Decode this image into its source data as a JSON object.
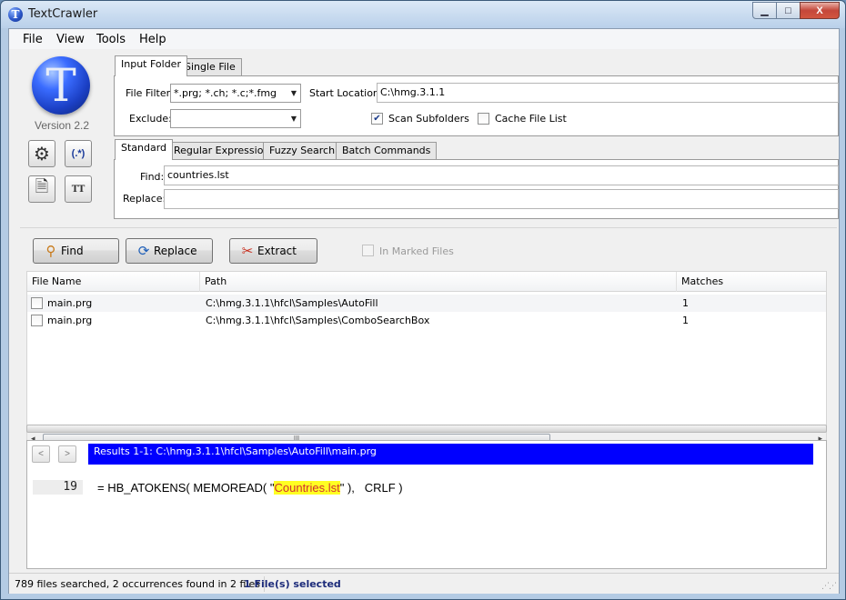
{
  "window": {
    "title": "TextCrawler",
    "app_icon_letter": "T",
    "minimize_glyph": "▁",
    "maximize_glyph": "□",
    "close_glyph": "X"
  },
  "menu": {
    "items": [
      "File",
      "View",
      "Tools",
      "Help"
    ]
  },
  "sidebar": {
    "logo_letter": "T",
    "version": "Version 2.2",
    "buttons": [
      {
        "icon": "gear-icon",
        "glyph": "⚙"
      },
      {
        "icon": "regex-icon",
        "glyph": "(.*)"
      },
      {
        "icon": "document-icon",
        "glyph": "🗎"
      },
      {
        "icon": "text-case-icon",
        "glyph": "TT"
      }
    ]
  },
  "source_tabs": {
    "tabs": [
      "Input Folder",
      "Single File"
    ],
    "active": "Input Folder"
  },
  "source": {
    "file_filter_label": "File Filter:",
    "file_filter_value": "*.prg; *.ch; *.c;*.fmg",
    "start_location_label": "Start Location:",
    "start_location_value": "C:\\hmg.3.1.1",
    "exclude_label": "Exclude:",
    "exclude_value": "",
    "scan_subfolders_label": "Scan Subfolders",
    "scan_subfolders_checked": true,
    "cache_file_list_label": "Cache File List",
    "cache_file_list_checked": false
  },
  "search_tabs": {
    "tabs": [
      "Standard",
      "Regular Expression",
      "Fuzzy Search",
      "Batch Commands"
    ],
    "active": "Standard"
  },
  "search": {
    "find_label": "Find:",
    "find_value": "countries.lst",
    "replace_label": "Replace:",
    "replace_value": ""
  },
  "toolbar": {
    "find_label": "Find",
    "replace_label": "Replace",
    "extract_label": "Extract",
    "in_marked_files_label": "In Marked Files",
    "in_marked_files_checked": false
  },
  "file_list": {
    "columns": [
      "File Name",
      "Path",
      "Matches"
    ],
    "rows": [
      {
        "name": "main.prg",
        "path": "C:\\hmg.3.1.1\\hfcl\\Samples\\AutoFill",
        "matches": "1",
        "checked": false
      },
      {
        "name": "main.prg",
        "path": "C:\\hmg.3.1.1\\hfcl\\Samples\\ComboSearchBox",
        "matches": "1",
        "checked": false
      }
    ],
    "scroll_left_glyph": "◂",
    "scroll_right_glyph": "▸",
    "scroll_thumb_grip": "|||"
  },
  "results": {
    "prev_glyph": "<",
    "next_glyph": ">",
    "header": "Results 1-1: C:\\hmg.3.1.1\\hfcl\\Samples\\AutoFill\\main.prg",
    "line_number": "19",
    "code_before": "= HB_ATOKENS( MEMOREAD( \"",
    "code_match": "Countries.lst",
    "code_after": "\" ),   CRLF )"
  },
  "status": {
    "summary": "789 files searched, 2 occurrences found in 2 files",
    "selected": "1 File(s) selected"
  },
  "colors": {
    "results_header_bg": "#0000ff",
    "match_highlight_bg": "#ffff22",
    "match_text": "#d03030",
    "selected_status_text": "#1c2b7a"
  }
}
